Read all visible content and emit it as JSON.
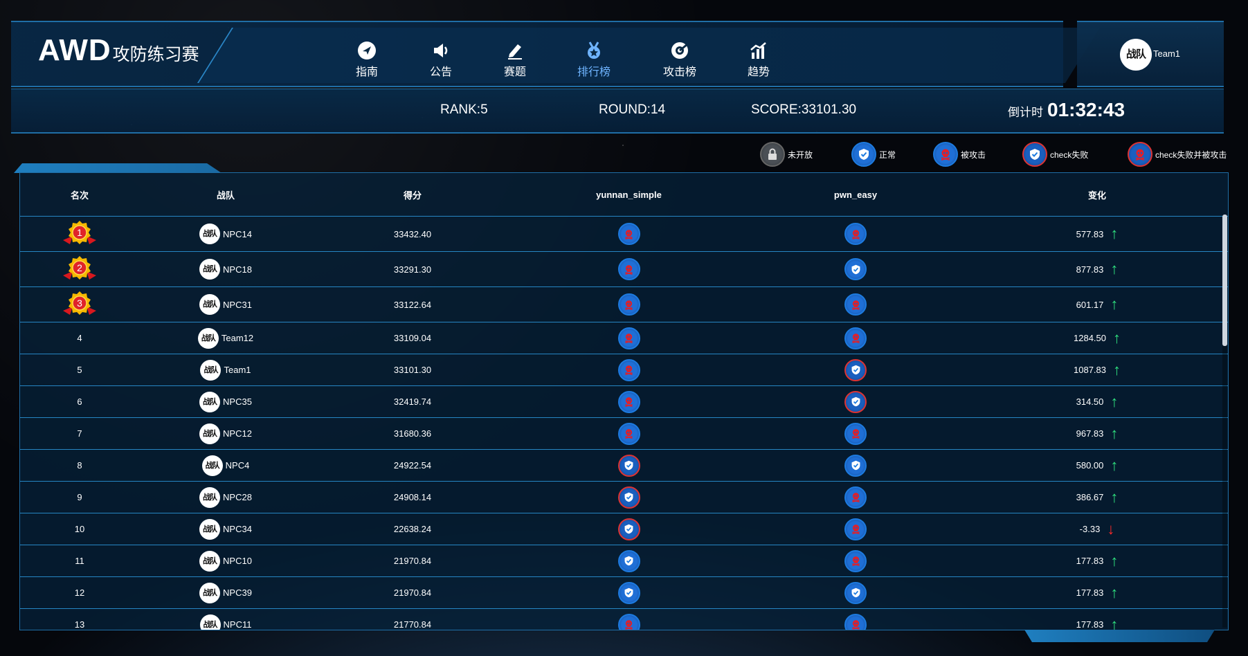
{
  "app": {
    "logo_main": "AWD",
    "logo_sub": "攻防练习赛"
  },
  "nav": [
    {
      "label": "指南",
      "icon": "compass-icon",
      "active": false
    },
    {
      "label": "公告",
      "icon": "megaphone-icon",
      "active": false
    },
    {
      "label": "赛题",
      "icon": "edit-icon",
      "active": false
    },
    {
      "label": "排行榜",
      "icon": "medal-icon",
      "active": true
    },
    {
      "label": "攻击榜",
      "icon": "target-icon",
      "active": false
    },
    {
      "label": "趋势",
      "icon": "chart-icon",
      "active": false
    }
  ],
  "user": {
    "avatar_text": "战队",
    "name": "Team1"
  },
  "status": {
    "rank": "RANK:5",
    "round": "ROUND:14",
    "score": "SCORE:33101.30",
    "countdown_label": "倒计时",
    "countdown": "01:32:43"
  },
  "legend": [
    {
      "label": "未开放",
      "state": "locked"
    },
    {
      "label": "正常",
      "state": "normal"
    },
    {
      "label": "被攻击",
      "state": "attacked"
    },
    {
      "label": "check失败",
      "state": "check-fail"
    },
    {
      "label": "check失败并被攻击",
      "state": "check-fail-attacked"
    }
  ],
  "table": {
    "headers": [
      "名次",
      "战队",
      "得分",
      "yunnan_simple",
      "pwn_easy",
      "变化"
    ],
    "rows": [
      {
        "rank": "1",
        "team": "NPC14",
        "score": "33432.40",
        "c1": "attacked",
        "c2": "attacked",
        "change": "577.83",
        "dir": "up"
      },
      {
        "rank": "2",
        "team": "NPC18",
        "score": "33291.30",
        "c1": "attacked",
        "c2": "normal",
        "change": "877.83",
        "dir": "up"
      },
      {
        "rank": "3",
        "team": "NPC31",
        "score": "33122.64",
        "c1": "attacked",
        "c2": "attacked",
        "change": "601.17",
        "dir": "up"
      },
      {
        "rank": "4",
        "team": "Team12",
        "score": "33109.04",
        "c1": "attacked",
        "c2": "attacked",
        "change": "1284.50",
        "dir": "up"
      },
      {
        "rank": "5",
        "team": "Team1",
        "score": "33101.30",
        "c1": "attacked",
        "c2": "check-fail",
        "change": "1087.83",
        "dir": "up"
      },
      {
        "rank": "6",
        "team": "NPC35",
        "score": "32419.74",
        "c1": "attacked",
        "c2": "check-fail",
        "change": "314.50",
        "dir": "up"
      },
      {
        "rank": "7",
        "team": "NPC12",
        "score": "31680.36",
        "c1": "attacked",
        "c2": "attacked",
        "change": "967.83",
        "dir": "up"
      },
      {
        "rank": "8",
        "team": "NPC4",
        "score": "24922.54",
        "c1": "check-fail",
        "c2": "normal",
        "change": "580.00",
        "dir": "up"
      },
      {
        "rank": "9",
        "team": "NPC28",
        "score": "24908.14",
        "c1": "check-fail",
        "c2": "attacked",
        "change": "386.67",
        "dir": "up"
      },
      {
        "rank": "10",
        "team": "NPC34",
        "score": "22638.24",
        "c1": "check-fail",
        "c2": "attacked",
        "change": "-3.33",
        "dir": "down"
      },
      {
        "rank": "11",
        "team": "NPC10",
        "score": "21970.84",
        "c1": "normal",
        "c2": "attacked",
        "change": "177.83",
        "dir": "up"
      },
      {
        "rank": "12",
        "team": "NPC39",
        "score": "21970.84",
        "c1": "normal",
        "c2": "normal",
        "change": "177.83",
        "dir": "up"
      },
      {
        "rank": "13",
        "team": "NPC11",
        "score": "21770.84",
        "c1": "attacked",
        "c2": "attacked",
        "change": "177.83",
        "dir": "up"
      }
    ]
  },
  "avatar_text": "战队",
  "colors": {
    "accent": "#6fb4ff",
    "up": "#2fe07f",
    "down": "#ff2a2a",
    "attack_red": "#e0202a",
    "shield_blue": "#1d7be0"
  }
}
